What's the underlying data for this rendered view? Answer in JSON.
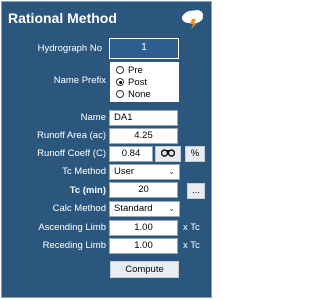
{
  "header": {
    "title": "Rational Method",
    "icon": "cloud-lightning-icon"
  },
  "fields": {
    "hydrograph_no": {
      "label": "Hydrograph No",
      "value": "1"
    },
    "name_prefix": {
      "label": "Name Prefix",
      "options": [
        "Pre",
        "Post",
        "None"
      ],
      "selected": "Post"
    },
    "name": {
      "label": "Name",
      "value": "DA1"
    },
    "runoff_area": {
      "label": "Runoff Area (ac)",
      "value": "4.25"
    },
    "runoff_coeff": {
      "label": "Runoff Coeff (C)",
      "value": "0.84",
      "percent_label": "%"
    },
    "tc_method": {
      "label": "Tc Method",
      "value": "User"
    },
    "tc": {
      "label": "Tc (min)",
      "value": "20",
      "browse_label": "..."
    },
    "calc_method": {
      "label": "Calc Method",
      "value": "Standard"
    },
    "ascending_limb": {
      "label": "Ascending Limb",
      "value": "1.00",
      "suffix": "x Tc"
    },
    "receding_limb": {
      "label": "Receding Limb",
      "value": "1.00",
      "suffix": "x Tc"
    }
  },
  "actions": {
    "compute_label": "Compute"
  },
  "colors": {
    "panel_bg": "#2b577f",
    "accent": "#2f5f8f"
  }
}
